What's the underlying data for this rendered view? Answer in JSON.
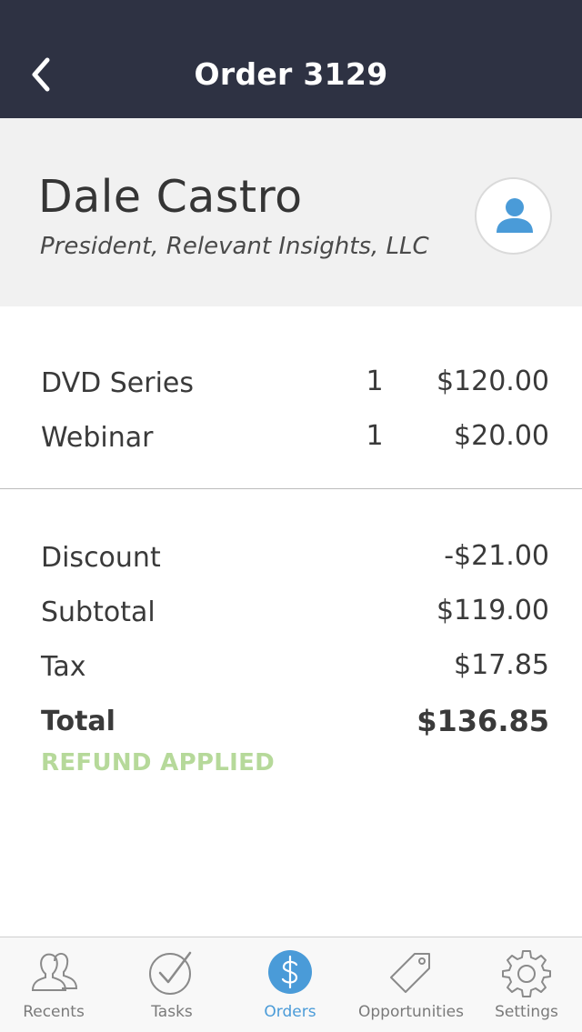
{
  "navbar": {
    "title": "Order 3129",
    "back_icon": "chevron-left-icon"
  },
  "customer": {
    "name": "Dale Castro",
    "role": "President, Relevant Insights, LLC",
    "avatar_icon": "person-icon"
  },
  "line_items": [
    {
      "label": "DVD Series",
      "qty": "1",
      "price": "$120.00"
    },
    {
      "label": "Webinar",
      "qty": "1",
      "price": "$20.00"
    }
  ],
  "totals": {
    "discount": {
      "label": "Discount",
      "value": "-$21.00"
    },
    "subtotal": {
      "label": "Subtotal",
      "value": "$119.00"
    },
    "tax": {
      "label": "Tax",
      "value": "$17.85"
    },
    "total": {
      "label": "Total",
      "value": "$136.85"
    },
    "status": "REFUND APPLIED"
  },
  "tabbar": {
    "tabs": [
      {
        "label": "Recents",
        "icon": "people-icon"
      },
      {
        "label": "Tasks",
        "icon": "checkmark-circle-icon"
      },
      {
        "label": "Orders",
        "icon": "dollar-circle-icon",
        "active": true
      },
      {
        "label": "Opportunities",
        "icon": "tag-icon"
      },
      {
        "label": "Settings",
        "icon": "gear-icon"
      }
    ]
  },
  "colors": {
    "navbar_bg": "#2e3243",
    "accent": "#4a9bd8",
    "refund_green": "#b6d99a",
    "header_bg": "#f1f1f1"
  }
}
